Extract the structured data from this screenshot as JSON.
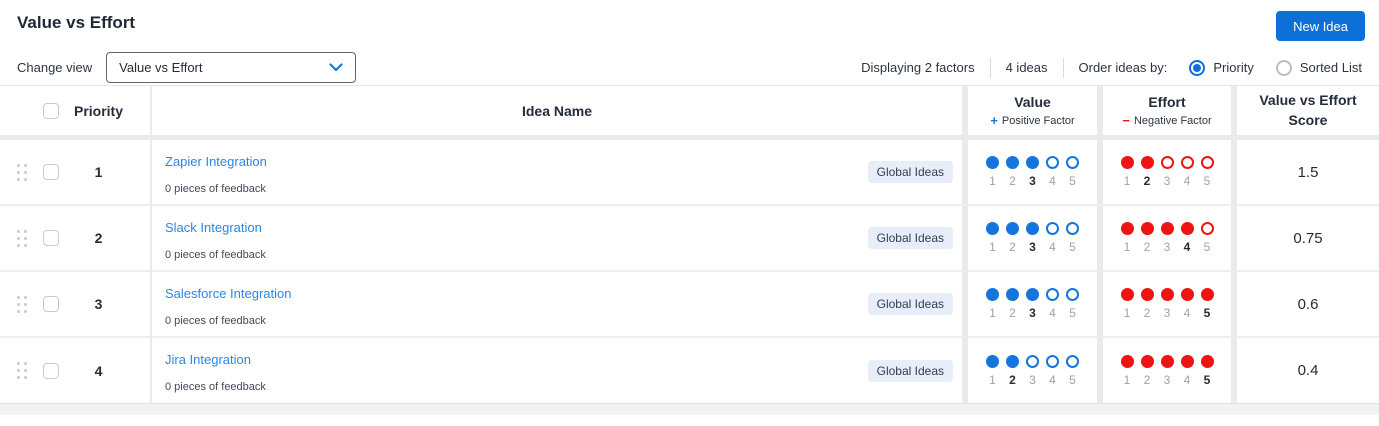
{
  "header": {
    "title": "Value vs Effort",
    "new_idea_button": "New Idea"
  },
  "toolbar": {
    "change_view_label": "Change view",
    "view_select_value": "Value vs Effort",
    "displaying_text": "Displaying 2 factors",
    "ideas_count": "4 ideas",
    "order_by_label": "Order ideas by:",
    "order_options": [
      {
        "label": "Priority",
        "selected": true
      },
      {
        "label": "Sorted List",
        "selected": false
      }
    ]
  },
  "table": {
    "headers": {
      "priority": "Priority",
      "idea_name": "Idea Name",
      "value_title": "Value",
      "value_icon": "+",
      "value_subtitle": "Positive Factor",
      "effort_title": "Effort",
      "effort_icon": "−",
      "effort_subtitle": "Negative Factor",
      "score": "Value vs Effort Score"
    },
    "rating_scale": [
      1,
      2,
      3,
      4,
      5
    ],
    "rows": [
      {
        "priority": "1",
        "name": "Zapier Integration",
        "feedback": "0 pieces of feedback",
        "tag": "Global Ideas",
        "value_rating": 3,
        "effort_rating": 2,
        "score": "1.5"
      },
      {
        "priority": "2",
        "name": "Slack Integration",
        "feedback": "0 pieces of feedback",
        "tag": "Global Ideas",
        "value_rating": 3,
        "effort_rating": 4,
        "score": "0.75"
      },
      {
        "priority": "3",
        "name": "Salesforce Integration",
        "feedback": "0 pieces of feedback",
        "tag": "Global Ideas",
        "value_rating": 3,
        "effort_rating": 5,
        "score": "0.6"
      },
      {
        "priority": "4",
        "name": "Jira Integration",
        "feedback": "0 pieces of feedback",
        "tag": "Global Ideas",
        "value_rating": 2,
        "effort_rating": 5,
        "score": "0.4"
      }
    ]
  },
  "colors": {
    "accent_blue": "#0d70d8",
    "value_blue": "#1476dd",
    "effort_red": "#ee1414",
    "link_blue": "#2b87e4"
  }
}
